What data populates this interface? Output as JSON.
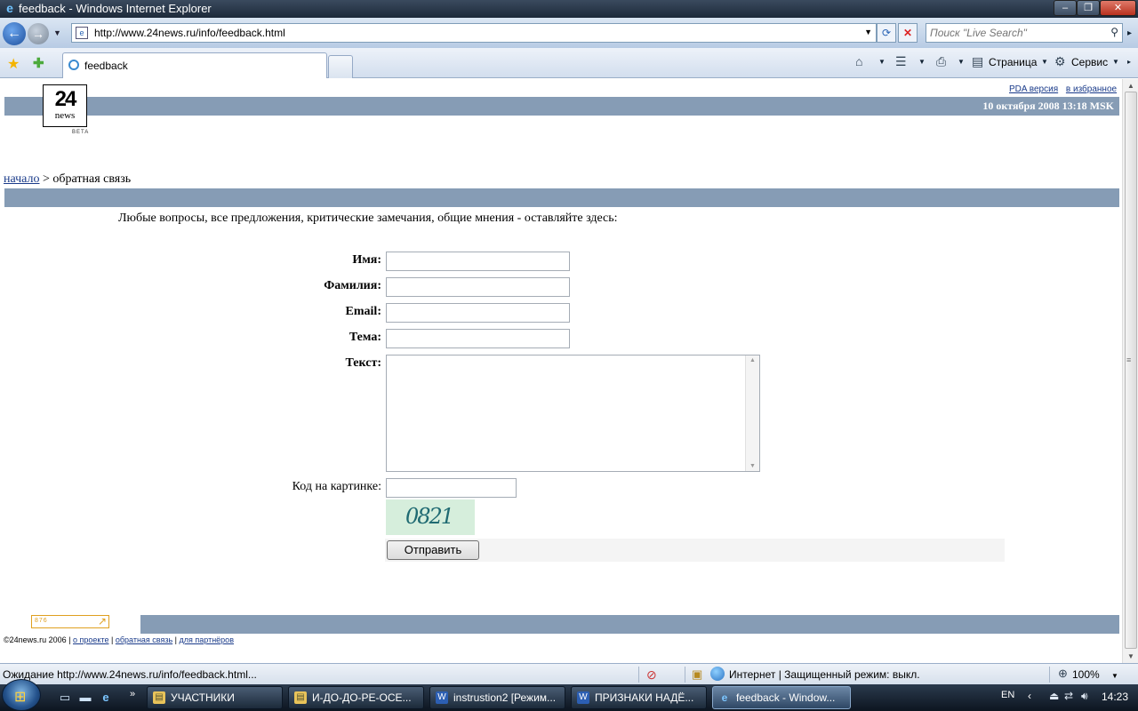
{
  "window": {
    "title": "feedback - Windows Internet Explorer"
  },
  "address_bar": {
    "url": "http://www.24news.ru/info/feedback.html"
  },
  "search": {
    "placeholder": "Поиск \"Live Search\""
  },
  "tab": {
    "label": "feedback"
  },
  "command_bar": {
    "page_label": "Страница",
    "tools_label": "Сервис"
  },
  "page": {
    "top_links": [
      "PDA версия",
      "в избранное"
    ],
    "date": "10 октября 2008  13:18 MSK",
    "logo": {
      "number": "24",
      "word": "news",
      "badge": "BETA"
    },
    "breadcrumb": {
      "home": "начало",
      "separator": ">",
      "current": "обратная связь"
    },
    "intro": "Любые вопросы, все предложения, критические замечания, общие мнения - оставляйте здесь:",
    "form": {
      "name_label": "Имя:",
      "surname_label": "Фамилия:",
      "email_label": "Email:",
      "subject_label": "Тема:",
      "text_label": "Текст:",
      "captcha_label": "Код на картинке:",
      "captcha_code": "0821",
      "submit_label": "Отправить"
    },
    "counter": "876",
    "footer": {
      "copyright": "©24news.ru 2006",
      "links": [
        "о проекте",
        "обратная связь",
        "для партнёров"
      ]
    }
  },
  "status_bar": {
    "text": "Ожидание http://www.24news.ru/info/feedback.html...",
    "zone": "Интернет | Защищенный режим: выкл.",
    "zoom": "100%"
  },
  "taskbar": {
    "tasks": [
      {
        "label": "УЧАСТНИКИ",
        "icon": "folder-icon",
        "active": false
      },
      {
        "label": "И-ДО-ДО-РЕ-ОСЕ...",
        "icon": "folder-icon",
        "active": false
      },
      {
        "label": "instrustion2 [Режим...",
        "icon": "word-icon",
        "active": false
      },
      {
        "label": "ПРИЗНАКИ НАДЁ...",
        "icon": "word-icon",
        "active": false
      },
      {
        "label": "feedback - Window...",
        "icon": "ie-icon",
        "active": true
      }
    ],
    "language": "EN",
    "clock": "14:23"
  }
}
